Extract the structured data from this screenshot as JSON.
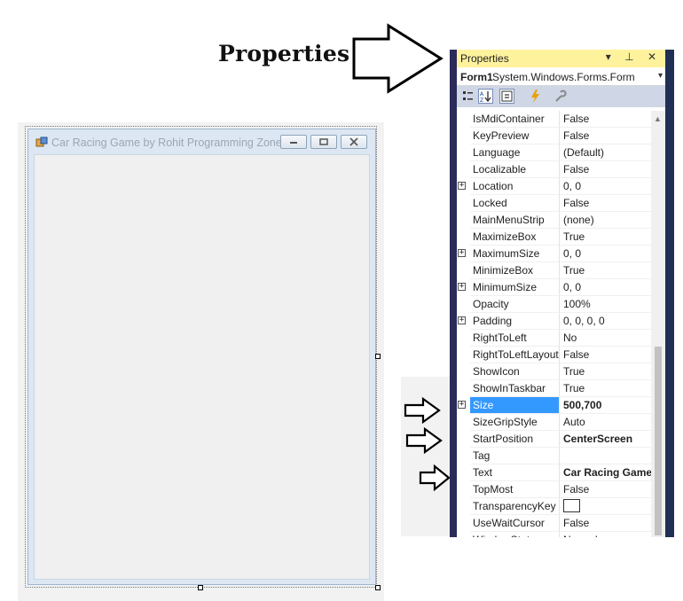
{
  "callout": {
    "label": "Properties"
  },
  "form_window": {
    "title": "Car Racing Game by Rohit Programming Zone",
    "controls": [
      "minimize",
      "maximize",
      "close"
    ]
  },
  "properties_panel": {
    "title": "Properties",
    "header_icons": "▾ ⊥ ✕",
    "object_name": "Form1",
    "object_type": "System.Windows.Forms.Form",
    "toolbar": [
      "categorized-icon",
      "alphabetical-icon",
      "properties-icon",
      "events-icon",
      "property-pages-icon"
    ],
    "rows": [
      {
        "name": "IsMdiContainer",
        "value": "False"
      },
      {
        "name": "KeyPreview",
        "value": "False"
      },
      {
        "name": "Language",
        "value": "(Default)"
      },
      {
        "name": "Localizable",
        "value": "False"
      },
      {
        "name": "Location",
        "value": "0, 0",
        "expandable": true
      },
      {
        "name": "Locked",
        "value": "False"
      },
      {
        "name": "MainMenuStrip",
        "value": "(none)"
      },
      {
        "name": "MaximizeBox",
        "value": "True"
      },
      {
        "name": "MaximumSize",
        "value": "0, 0",
        "expandable": true
      },
      {
        "name": "MinimizeBox",
        "value": "True"
      },
      {
        "name": "MinimumSize",
        "value": "0, 0",
        "expandable": true
      },
      {
        "name": "Opacity",
        "value": "100%"
      },
      {
        "name": "Padding",
        "value": "0, 0, 0, 0",
        "expandable": true
      },
      {
        "name": "RightToLeft",
        "value": "No"
      },
      {
        "name": "RightToLeftLayout",
        "value": "False"
      },
      {
        "name": "ShowIcon",
        "value": "True"
      },
      {
        "name": "ShowInTaskbar",
        "value": "True"
      },
      {
        "name": "Size",
        "value": "500,700",
        "expandable": true,
        "selected": true,
        "bold": true
      },
      {
        "name": "SizeGripStyle",
        "value": "Auto"
      },
      {
        "name": "StartPosition",
        "value": "CenterScreen",
        "bold": true
      },
      {
        "name": "Tag",
        "value": ""
      },
      {
        "name": "Text",
        "value": "Car Racing Game",
        "bold": true
      },
      {
        "name": "TopMost",
        "value": "False"
      },
      {
        "name": "TransparencyKey",
        "value": "",
        "swatch": true
      },
      {
        "name": "UseWaitCursor",
        "value": "False"
      },
      {
        "name": "WindowState",
        "value": "Normal"
      }
    ]
  },
  "colors": {
    "panel_header": "#fff29d",
    "selection": "#3399ff",
    "toolbar": "#cfd6e5"
  }
}
